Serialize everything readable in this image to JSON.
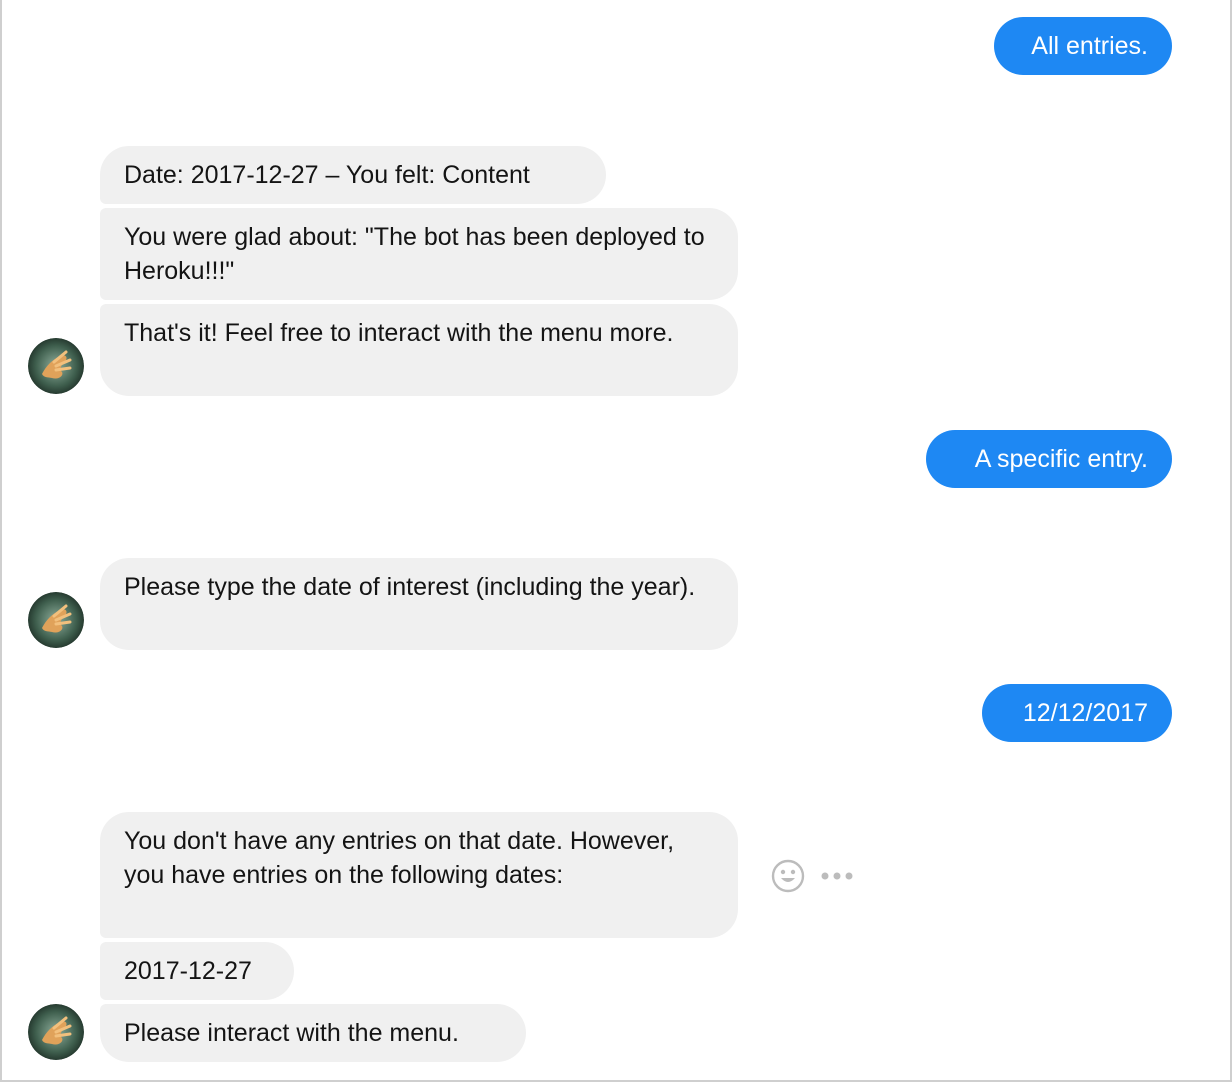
{
  "conversation": {
    "outgoing": [
      {
        "text": "All entries."
      },
      {
        "text": "A specific entry."
      },
      {
        "text": "12/12/2017"
      }
    ],
    "incoming": [
      {
        "text": "Date: 2017-12-27 – You felt: Content"
      },
      {
        "text": "You were glad about: \"The bot has been deployed to Heroku!!!\""
      },
      {
        "text": "That's it! Feel free to interact with the menu more."
      },
      {
        "text": "Please type the date of interest (including the year)."
      },
      {
        "text": "You don't have any entries on that date. However, you have entries on the following dates:"
      },
      {
        "text": "2017-12-27"
      },
      {
        "text": "Please interact with the menu."
      }
    ]
  },
  "icons": {
    "avatar": "bot-avatar",
    "react": "smiley-face-icon",
    "more": "more-options-icon"
  },
  "colors": {
    "outgoing_bubble": "#1e88f3",
    "incoming_bubble": "#f0f0f0",
    "outgoing_text": "#ffffff",
    "incoming_text": "#141414",
    "icon_gray": "#bcbcbc"
  }
}
